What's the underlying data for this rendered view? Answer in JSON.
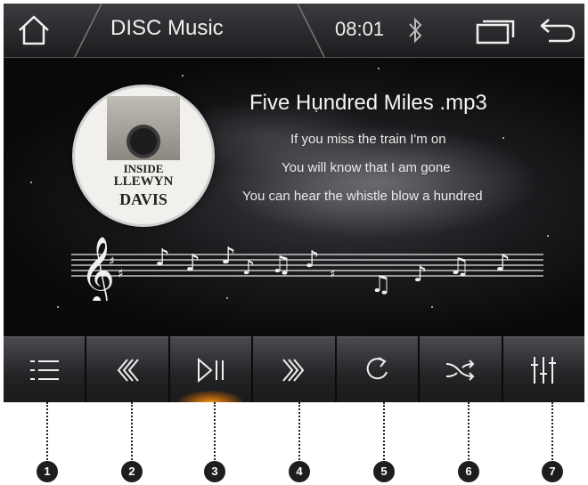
{
  "header": {
    "title": "DISC Music",
    "time": "08:01",
    "icons": [
      "home-icon",
      "bluetooth-icon",
      "window-icon",
      "back-icon"
    ]
  },
  "album": {
    "line1": "INSIDE",
    "line2": "LLEWYN",
    "line3": "DAVIS"
  },
  "track": {
    "title": "Five Hundred Miles .mp3",
    "lyrics": [
      "If you miss the train I'm on",
      "You will know that I am gone",
      "You can hear the whistle blow a hundred"
    ]
  },
  "controls": [
    {
      "icon": "playlist-icon"
    },
    {
      "icon": "rewind-icon"
    },
    {
      "icon": "play-pause-icon",
      "active": true
    },
    {
      "icon": "fast-forward-icon"
    },
    {
      "icon": "repeat-icon"
    },
    {
      "icon": "shuffle-icon"
    },
    {
      "icon": "equalizer-icon"
    }
  ],
  "callouts": [
    "1",
    "2",
    "3",
    "4",
    "5",
    "6",
    "7"
  ],
  "colors": {
    "accent": "#ff9a1e",
    "background": "#141416",
    "text": "#f0f0f0"
  }
}
